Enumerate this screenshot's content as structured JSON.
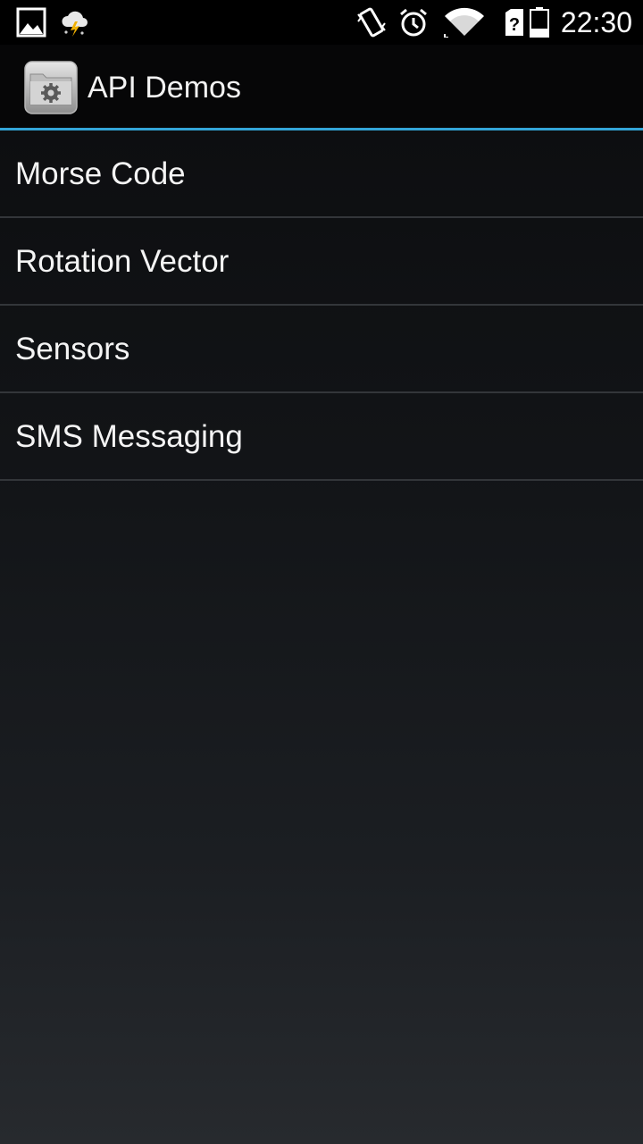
{
  "status_bar": {
    "icons_left": [
      "gallery-notification-icon",
      "weather-storm-icon"
    ],
    "icons_right": [
      "vibrate-icon",
      "alarm-icon",
      "wifi-icon",
      "sim-unknown-icon",
      "battery-low-icon"
    ],
    "time": "22:30"
  },
  "action_bar": {
    "app_icon": "settings-folder-icon",
    "title": "API Demos",
    "divider_color": "#33a5d8"
  },
  "list": {
    "items": [
      {
        "label": "Morse Code"
      },
      {
        "label": "Rotation Vector"
      },
      {
        "label": "Sensors"
      },
      {
        "label": "SMS Messaging"
      }
    ]
  }
}
